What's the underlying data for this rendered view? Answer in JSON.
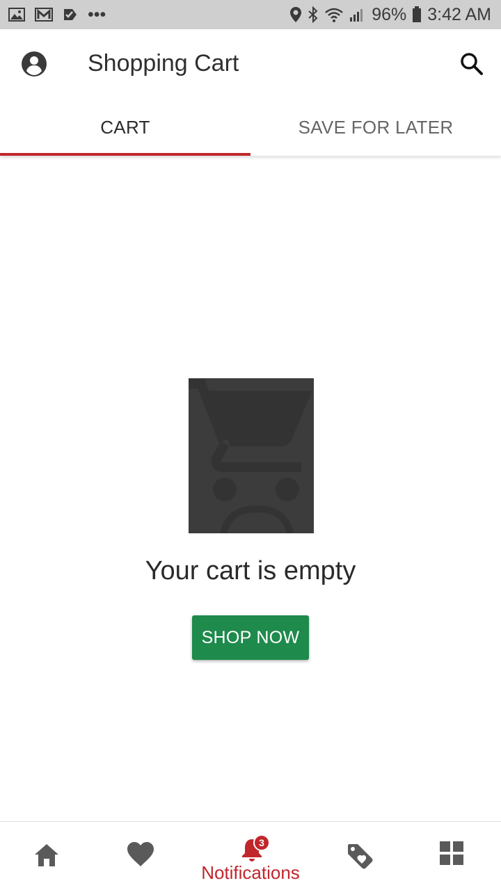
{
  "status_bar": {
    "battery": "96%",
    "time": "3:42 AM",
    "more_indicator": "•••",
    "icons_left": [
      "gallery-icon",
      "mail-icon",
      "check-notification-icon",
      "more-dots-icon"
    ],
    "icons_right": [
      "location-icon",
      "bluetooth-icon",
      "wifi-icon",
      "signal-icon",
      "battery-icon"
    ]
  },
  "app_bar": {
    "title": "Shopping Cart",
    "left_icon": "account-circle-icon",
    "right_icon": "search-icon"
  },
  "tabs": [
    {
      "label": "CART",
      "active": true
    },
    {
      "label": "SAVE FOR LATER",
      "active": false
    }
  ],
  "empty_state": {
    "illustration_icon": "sad-cart-icon",
    "message": "Your cart is empty",
    "button_label": "SHOP NOW"
  },
  "bottom_nav": {
    "items": [
      {
        "icon": "home-icon",
        "label": ""
      },
      {
        "icon": "heart-icon",
        "label": ""
      },
      {
        "icon": "bell-icon",
        "label": "Notifications",
        "badge": "3",
        "active": true
      },
      {
        "icon": "tag-heart-icon",
        "label": ""
      },
      {
        "icon": "grid-icon",
        "label": ""
      }
    ]
  },
  "colors": {
    "accent": "#c0272d",
    "button": "#1e8a4c",
    "status_bar": "#cfcfcf",
    "illustration_bg": "#3c3c3c"
  }
}
